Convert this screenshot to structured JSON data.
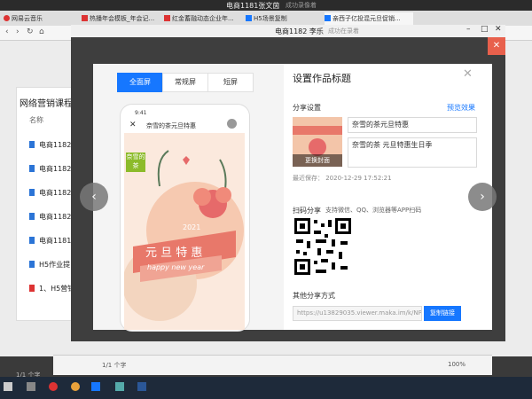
{
  "meeting_bar": {
    "title": "电商1181张文茵",
    "status": "成功录像着"
  },
  "browser": {
    "tabs": [
      {
        "label": "网易云音乐",
        "color": "#d33"
      },
      {
        "label": "热播年会模板_年会记...",
        "color": "#d33"
      },
      {
        "label": "红金蓄融动态企业年...",
        "color": "#d33"
      },
      {
        "label": "H5场景复制",
        "color": "#1677ff"
      },
      {
        "label": "亲西子亿投混元旦促销...",
        "color": "#1677ff"
      }
    ]
  },
  "underlying_page": {
    "panel_title": "网络营销课程",
    "column_header": "名称",
    "files": [
      {
        "name": "电商1182",
        "type": "doc"
      },
      {
        "name": "电商1182",
        "type": "doc"
      },
      {
        "name": "电商1182",
        "type": "doc"
      },
      {
        "name": "电商1182",
        "type": "doc"
      },
      {
        "name": "电商1181",
        "type": "doc"
      },
      {
        "name": "H5作业提",
        "type": "doc"
      },
      {
        "name": "1、H5营销",
        "type": "pdf"
      }
    ],
    "status_left": "1/1 个字",
    "page_info": "1/1 个字",
    "zoom": "100%"
  },
  "share_window": {
    "title": "电商1182 李乐",
    "title_status": "成功在录着"
  },
  "modal": {
    "view_tabs": [
      "全面屏",
      "常规屏",
      "短屏"
    ],
    "active_tab": 0,
    "phone_time": "9:41",
    "phone_title": "奈雪的茶元旦特惠",
    "poster": {
      "brand": "奈雪的茶",
      "year": "2021",
      "main": "元 旦 特 惠",
      "sub": "happy new year"
    },
    "settings_title": "设置作品标题",
    "share_settings": "分享设置",
    "preview_link": "预览效果",
    "title_input": "奈雪的茶元旦特惠",
    "desc_input": "奈雪的茶 元旦特惠生日季",
    "change_cover": "更换封面",
    "last_saved": "最近保存：  2020-12-29 17:52:21",
    "qr_label": "扫码分享",
    "qr_desc": "支持微信、QQ、浏览器等APP扫码",
    "other_share": "其他分享方式",
    "share_url": "https://u13829035.viewer.maka.im/k/NP1C",
    "copy_button": "复制链接"
  },
  "colors": {
    "accent": "#1677ff",
    "close_red": "#e8604c"
  }
}
